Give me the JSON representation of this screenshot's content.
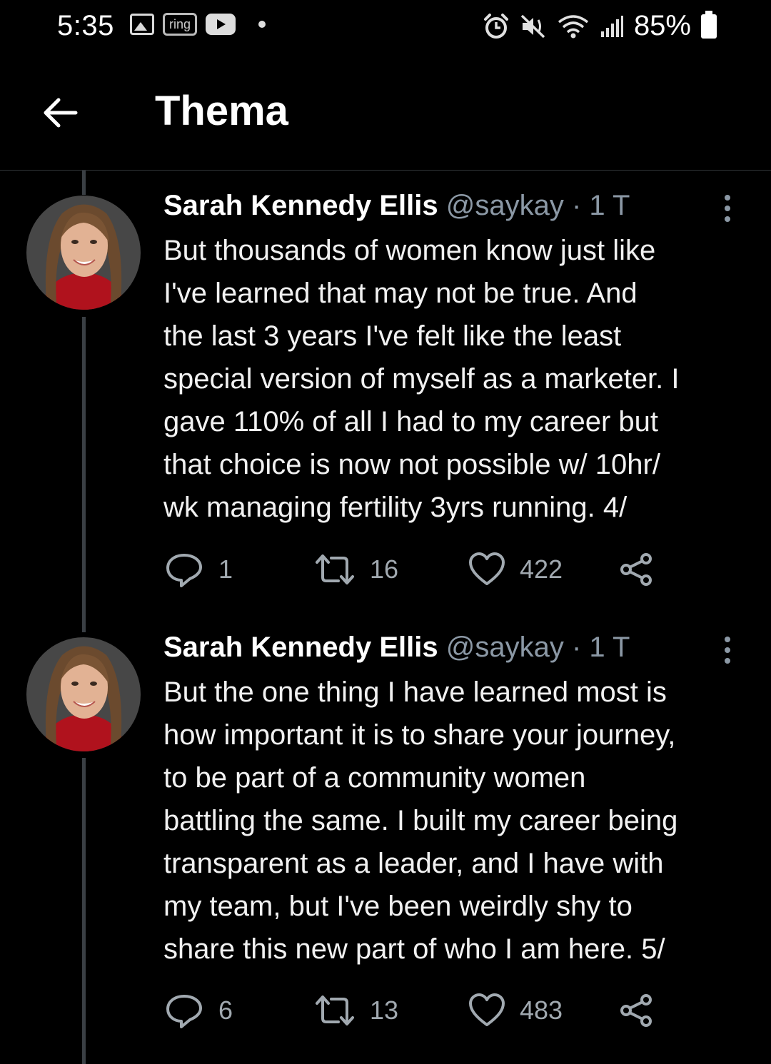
{
  "status_bar": {
    "time": "5:35",
    "ring_label": "ring",
    "battery": "85%",
    "icons": [
      "gallery-icon",
      "ring-icon",
      "youtube-icon",
      "notification-dot",
      "alarm-icon",
      "mute-icon",
      "wifi-icon",
      "signal-icon",
      "battery-icon"
    ]
  },
  "header": {
    "title": "Thema"
  },
  "tweets": [
    {
      "name": "Sarah Kennedy Ellis",
      "handle": "@saykay",
      "sep": "·",
      "time": "1 T",
      "text_lines": [
        "But thousands of women know just like",
        "I've learned that may not be true. And",
        "the last 3 years I've felt like the least",
        "special version of myself as a marketer. I",
        "gave 110% of all I had to my career but",
        "that choice is now not possible w/ 10hr/",
        "wk managing fertility 3yrs running. 4/"
      ],
      "replies": "1",
      "retweets": "16",
      "likes": "422"
    },
    {
      "name": "Sarah Kennedy Ellis",
      "handle": "@saykay",
      "sep": "·",
      "time": "1 T",
      "text_lines": [
        "But the one thing I have learned most is",
        "how important it is to share your journey,",
        "to be part of a community women",
        "battling the same. I built my career being",
        "transparent as a leader, and I have with",
        "my team, but I've been weirdly shy to",
        "share this new part of who I am here. 5/"
      ],
      "replies": "6",
      "retweets": "13",
      "likes": "483"
    }
  ],
  "colors": {
    "background": "#000000",
    "text": "#f1f1f1",
    "muted": "#8b98a5",
    "divider": "#2f3336"
  }
}
